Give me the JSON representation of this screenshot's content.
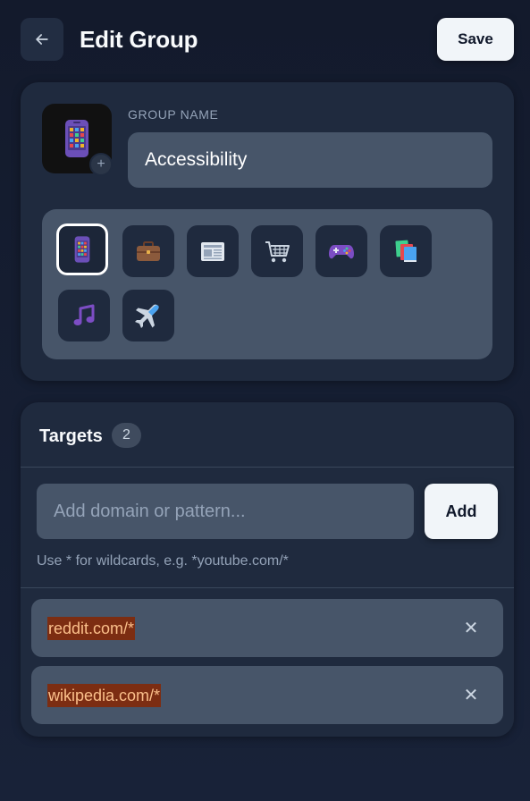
{
  "header": {
    "title": "Edit Group",
    "save_label": "Save",
    "back_icon": "arrow-left-icon"
  },
  "group": {
    "name_label": "GROUP NAME",
    "name_value": "Accessibility",
    "add_icon_glyph": "+",
    "selected_icon": "mobile-phone-icon",
    "icon_options": [
      "mobile-phone-icon",
      "briefcase-icon",
      "newspaper-icon",
      "shopping-cart-icon",
      "game-controller-icon",
      "books-icon",
      "music-note-icon",
      "airplane-icon"
    ]
  },
  "targets": {
    "title": "Targets",
    "count": "2",
    "input_placeholder": "Add domain or pattern...",
    "input_value": "",
    "add_label": "Add",
    "hint": "Use * for wildcards, e.g. *youtube.com/*",
    "remove_glyph": "✕",
    "items": [
      {
        "pattern": "reddit.com/*"
      },
      {
        "pattern": "wikipedia.com/*"
      }
    ]
  },
  "colors": {
    "background": "#141b2d",
    "card": "#1f2a3e",
    "input": "#475569",
    "button_light": "#f1f5f9",
    "highlight_bg": "#7c2d12",
    "highlight_text": "#fbbf8a"
  }
}
